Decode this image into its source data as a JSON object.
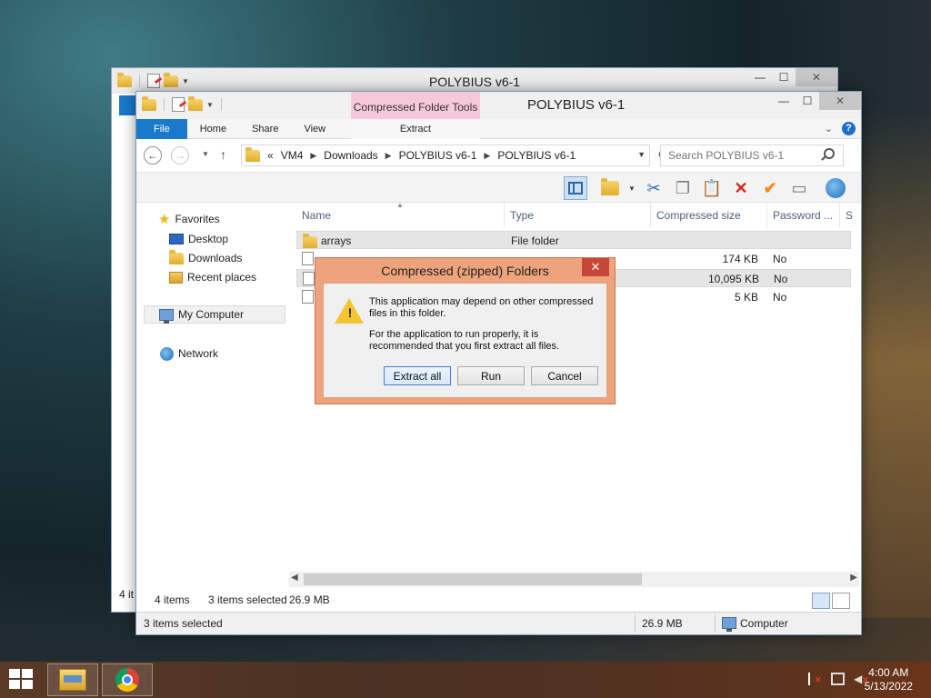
{
  "back_window": {
    "title": "POLYBIUS v6-1",
    "status": "4 it"
  },
  "window": {
    "title": "POLYBIUS v6-1",
    "context_tab_group": "Compressed Folder Tools",
    "controls": {
      "minimize": "—",
      "maximize": "☐",
      "close": "✕"
    }
  },
  "ribbon": {
    "tabs": [
      "File",
      "Home",
      "Share",
      "View"
    ],
    "context_tab": "Extract",
    "help": "?"
  },
  "address": {
    "overflow": "«",
    "crumbs": [
      "VM4",
      "Downloads",
      "POLYBIUS v6-1",
      "POLYBIUS v6-1"
    ],
    "search_placeholder": "Search POLYBIUS v6-1"
  },
  "nav_pane": {
    "favorites": "Favorites",
    "desktop": "Desktop",
    "downloads": "Downloads",
    "recent": "Recent places",
    "computer": "My Computer",
    "network": "Network"
  },
  "columns": [
    "Name",
    "Type",
    "Compressed size",
    "Password ...",
    "Si"
  ],
  "rows": [
    {
      "name": "arrays",
      "type": "File folder",
      "size": "",
      "password": ""
    },
    {
      "name": "",
      "type": "",
      "size": "174 KB",
      "password": "No"
    },
    {
      "name": "",
      "type": "",
      "size": "10,095 KB",
      "password": "No"
    },
    {
      "name": "",
      "type": "",
      "size": "5 KB",
      "password": "No"
    }
  ],
  "inner_status": {
    "count": "4 items",
    "selected": "3 items selected",
    "size": "26.9 MB"
  },
  "status_bar": {
    "selected": "3 items selected",
    "size": "26.9 MB",
    "location": "Computer"
  },
  "dialog": {
    "title": "Compressed (zipped) Folders",
    "close": "✕",
    "message1": "This application may depend on other compressed files in this folder.",
    "message2": "For the application to run properly, it is recommended that you first extract all files.",
    "buttons": {
      "extract": "Extract all",
      "run": "Run",
      "cancel": "Cancel"
    }
  },
  "taskbar": {
    "time": "4:00 AM",
    "date": "5/13/2022"
  },
  "icons": {
    "toolbar": [
      "preview-pane-icon",
      "folder-options-icon",
      "cut-icon",
      "copy-icon",
      "paste-icon",
      "delete-icon",
      "checkmark-icon",
      "rename-icon",
      "globe-icon"
    ]
  }
}
